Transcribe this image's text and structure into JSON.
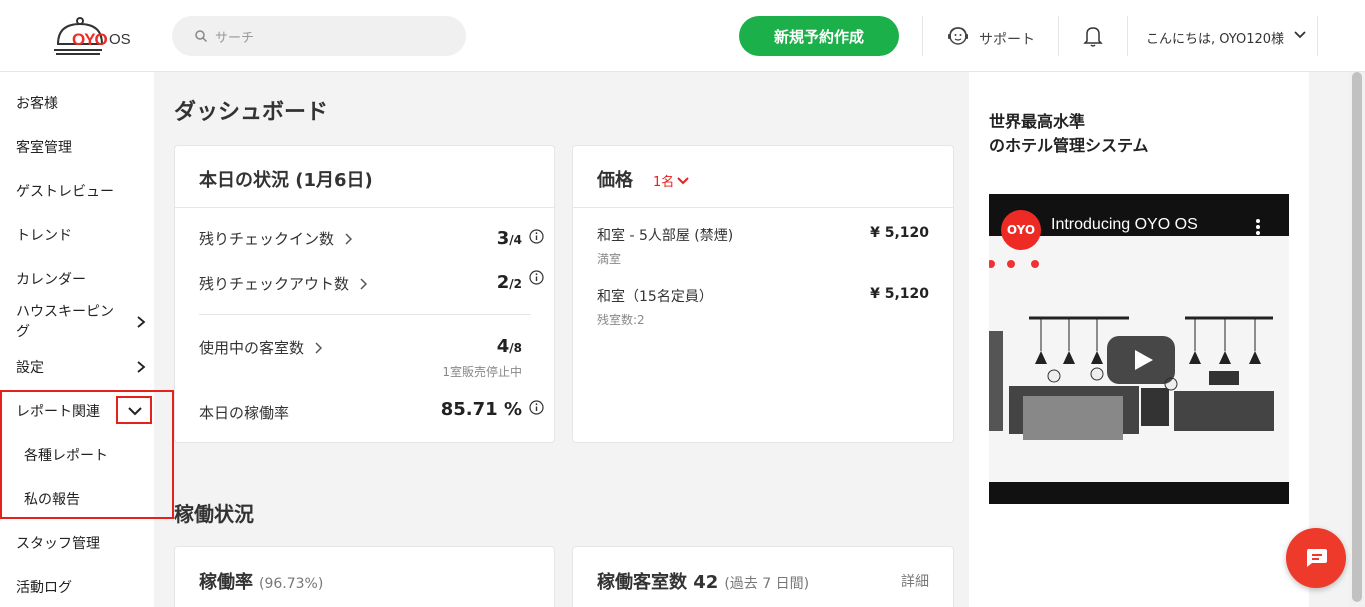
{
  "header": {
    "logo_text": "OYO",
    "logo_suffix": "OS",
    "search_placeholder": "サーチ",
    "new_booking_label": "新規予約作成",
    "support_label": "サポート",
    "greeting": "こんにちは, OYO120様"
  },
  "sidebar": {
    "items": [
      {
        "label": "お客様"
      },
      {
        "label": "客室管理"
      },
      {
        "label": "ゲストレビュー"
      },
      {
        "label": "トレンド"
      },
      {
        "label": "カレンダー"
      },
      {
        "label": "ハウスキーピング"
      },
      {
        "label": "設定"
      },
      {
        "label": "レポート関連"
      },
      {
        "label": "スタッフ管理"
      },
      {
        "label": "活動ログ"
      }
    ],
    "sub_items": [
      {
        "label": "各種レポート"
      },
      {
        "label": "私の報告"
      }
    ]
  },
  "main": {
    "title": "ダッシュボード",
    "status_card": {
      "title": "本日の状況 (1月6日)",
      "checkin_label": "残りチェックイン数",
      "checkin_value": "3",
      "checkin_total": "/4",
      "checkout_label": "残りチェックアウト数",
      "checkout_value": "2",
      "checkout_total": "/2",
      "rooms_label": "使用中の客室数",
      "rooms_value": "4",
      "rooms_total": "/8",
      "rooms_note": "1室販売停止中",
      "occupancy_label": "本日の稼働率",
      "occupancy_value": "85.71 %"
    },
    "price_card": {
      "title": "価格",
      "guests": "1名",
      "rooms": [
        {
          "name": "和室 - 5人部屋 (禁煙)",
          "status": "満室",
          "price": "¥ 5,120"
        },
        {
          "name": "和室（15名定員）",
          "status": "残室数:2",
          "price": "¥ 5,120"
        }
      ]
    },
    "section_title": "稼働状況",
    "occupancy_card": {
      "title": "稼働率",
      "value": "(96.73%)"
    },
    "rooms_occ_card": {
      "title": "稼働客室数 42",
      "period": "(過去 7 日間)",
      "detail_link": "詳細"
    }
  },
  "right_panel": {
    "title_line1": "世界最高水準",
    "title_line2": "のホテル管理システム",
    "video_title": "Introducing OYO OS",
    "video_logo": "OYO"
  },
  "colors": {
    "brand_red": "#ee2a24",
    "primary_green": "#1bb04a",
    "highlight_red": "#e8201b"
  }
}
